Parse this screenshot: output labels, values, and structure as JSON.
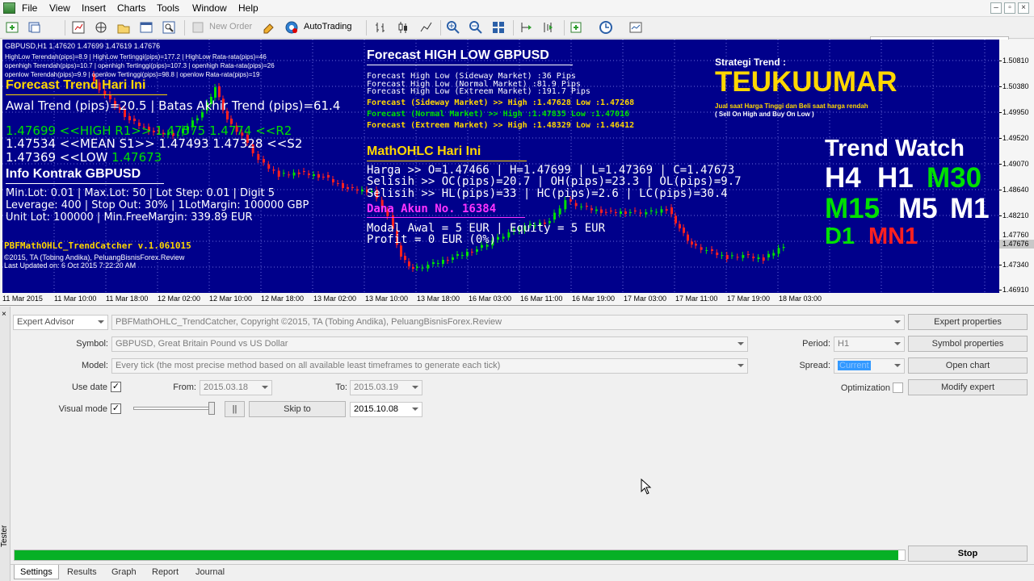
{
  "menu": [
    "File",
    "View",
    "Insert",
    "Charts",
    "Tools",
    "Window",
    "Help"
  ],
  "toolbar": {
    "new_order": "New Order",
    "autotrading": "AutoTrading",
    "search_placeholder": ""
  },
  "chart": {
    "symbol_line": "GBPUSD,H1  1.47620 1.47699 1.47619 1.47676",
    "stats": [
      "HighLow Terendah(pips)=8.9 | HighLow Tertinggi(pips)=177.2 | HighLow Rata-rata(pips)=46",
      "openhigh Terendah(pips)=10.7 | openhigh Tertinggi(pips)=107.3 | openhigh Rata-rata(pips)=26",
      "openlow Terendah(pips)=9.9 | openlow Tertinggi(pips)=98.8 | openlow Rata-rata(pips)=19"
    ],
    "forecast_trend_title": "Forecast Trend Hari Ini",
    "awal_trend": "Awal Trend (pips)=20.5 | Batas Akhir Trend (pips)=61.4",
    "pivot_high": "1.47699 <<HIGH  R1>> 1.47575  1.4774 <<R2",
    "pivot_mean": "1.47534 <<MEAN S1>> 1.47493 1.47328 <<S2",
    "pivot_low_label": "1.47369 <<LOW  ",
    "pivot_low_value": "1.47673",
    "info_title": "Info Kontrak GBPUSD",
    "info_lines": [
      "Min.Lot: 0.01 | Max.Lot: 50 | Lot Step: 0.01 | Digit 5",
      "Leverage: 400 | Stop Out: 30% | 1LotMargin: 100000 GBP",
      "Unit Lot: 100000 | Min.FreeMargin: 339.89 EUR"
    ],
    "ea_name": "PBFMathOHLC_TrendCatcher v.1.061015",
    "copyright": "©2015, TA (Tobing Andika), PeluangBisnisForex.Review",
    "last_updated": "Last Updated on: 6 Oct 2015 7:22:20 AM",
    "forecast_hl_title": "Forecast HIGH LOW GBPUSD",
    "forecast_hl": [
      "Forecast High Low (Sideway Market) :36 Pips",
      "Forecast High Low (Normal Market) :81.9 Pips",
      "Forecast High Low (Extreem Market) :191.7 Pips"
    ],
    "fc_sideway": "Forecast (Sideway Market) >> High :1.47628 Low :1.47268",
    "fc_normal": "Forecast (Normal Market) >> High :1.47835 Low :1.47016",
    "fc_extreem": "Forecast (Extreem Market) >> High :1.48329 Low :1.46412",
    "mathohlc_title": "MathOHLC Hari Ini",
    "mathohlc_lines": [
      "Harga  >> O=1.47466 | H=1.47699 | L=1.47369 | C=1.47673",
      "Selisih >> OC(pips)=20.7 | OH(pips)=23.3 | OL(pips)=9.7",
      "Selisih >> HL(pips)=33 | HC(pips)=2.6 | LC(pips)=30.4"
    ],
    "dana_akun": "Dana Akun No. 16384",
    "modal_line": "Modal Awal  = 5 EUR | Equity  = 5 EUR",
    "profit_line": "Profit  = 0 EUR (0%)",
    "strategi_label": "Strategi Trend :",
    "brand": "TEUKUUMAR",
    "tagline_1": "Jual saat Harga Tinggi dan Beli saat harga rendah",
    "tagline_2": "( Sell On High and Buy On Low )",
    "trend_watch_title": "Trend Watch",
    "tf_h4": "H4",
    "tf_h1": "H1",
    "tf_m30": "M30",
    "tf_m15": "M15",
    "tf_m5": "M5",
    "tf_m1": "M1",
    "tf_d1": "D1",
    "tf_mn1": "MN1",
    "colors": {
      "background": "#00008b",
      "bull": "#00e000",
      "bear": "#ff2020",
      "highlight": "#ffd700"
    }
  },
  "price_axis": [
    "1.50810",
    "1.50380",
    "1.49950",
    "1.49520",
    "1.49070",
    "1.48640",
    "1.48210",
    "1.47760",
    "1.47340",
    "1.46910"
  ],
  "price_current": "1.47676",
  "time_axis": [
    "11 Mar 2015",
    "11 Mar 10:00",
    "11 Mar 18:00",
    "12 Mar 02:00",
    "12 Mar 10:00",
    "12 Mar 18:00",
    "13 Mar 02:00",
    "13 Mar 10:00",
    "13 Mar 18:00",
    "16 Mar 03:00",
    "16 Mar 11:00",
    "16 Mar 19:00",
    "17 Mar 03:00",
    "17 Mar 11:00",
    "17 Mar 19:00",
    "18 Mar 03:00"
  ],
  "tester": {
    "side_label": "Tester",
    "type": "Expert Advisor",
    "expert": "PBFMathOHLC_TrendCatcher, Copyright ©2015, TA (Tobing Andika), PeluangBisnisForex.Review",
    "symbol_label": "Symbol:",
    "symbol": "GBPUSD, Great Britain Pound vs US Dollar",
    "model_label": "Model:",
    "model": "Every tick (the most precise method based on all available least timeframes to generate each tick)",
    "use_date_label": "Use date",
    "from_label": "From:",
    "from": "2015.03.18",
    "to_label": "To:",
    "to": "2015.03.19",
    "visual_mode_label": "Visual mode",
    "pause": "||",
    "skip_to": "Skip to",
    "skip_date": "2015.10.08",
    "period_label": "Period:",
    "period": "H1",
    "spread_label": "Spread:",
    "spread": "Current",
    "optimization_label": "Optimization",
    "check": "✓",
    "expert_properties": "Expert properties",
    "symbol_properties": "Symbol properties",
    "open_chart": "Open chart",
    "modify_expert": "Modify expert",
    "stop": "Stop",
    "progress": 0.993,
    "tabs": [
      "Settings",
      "Results",
      "Graph",
      "Report",
      "Journal"
    ]
  }
}
